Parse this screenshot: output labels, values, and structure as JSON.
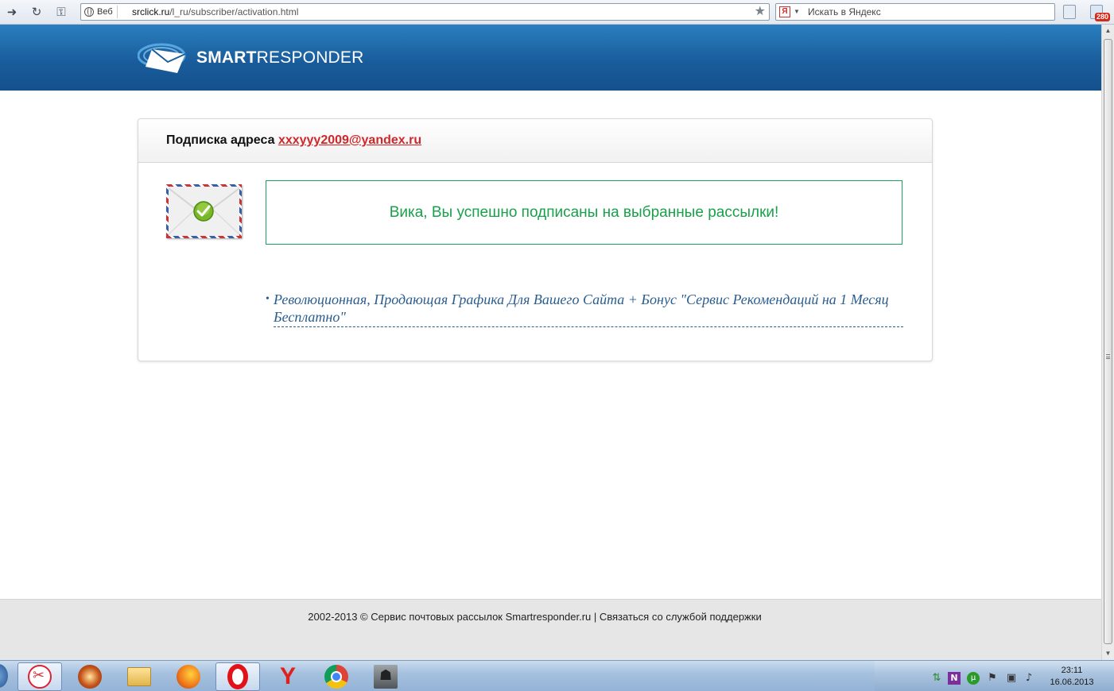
{
  "browser": {
    "web_label": "Веб",
    "url_host": "srclick.ru",
    "url_path": "/l_ru/subscriber/activation.html",
    "search_placeholder": "Искать в Яндекс",
    "ya_badge": "Я",
    "notification_count": "280"
  },
  "header": {
    "logo_bold": "SMART",
    "logo_regular": "RESPONDER"
  },
  "card": {
    "title_prefix": "Подписка адреса",
    "email": "xxxyyy2009@yandex.ru",
    "success_message": "Вика, Вы успешно подписаны на выбранные рассылки!",
    "bullet": "•",
    "subscriptions": [
      {
        "title": "Революционная, Продающая Графика Для Вашего Сайта + Бонус \"Сервис Рекомендаций на 1 Месяц Бесплатно\""
      }
    ]
  },
  "footer": {
    "text": "2002-2013 © Сервис почтовых рассылок Smartresponder.ru | Связаться со службой поддержки"
  },
  "taskbar": {
    "apps": [
      "snipping-tool",
      "media-player",
      "explorer",
      "firefox",
      "opera",
      "yandex-browser",
      "chrome",
      "counter-strike"
    ],
    "active_app": "opera",
    "time": "23:11",
    "date": "16.06.2013"
  },
  "colors": {
    "header_blue": "#1a5d9c",
    "success_green": "#18a04a",
    "email_red": "#d0282a",
    "link_blue": "#2a5d8f"
  }
}
